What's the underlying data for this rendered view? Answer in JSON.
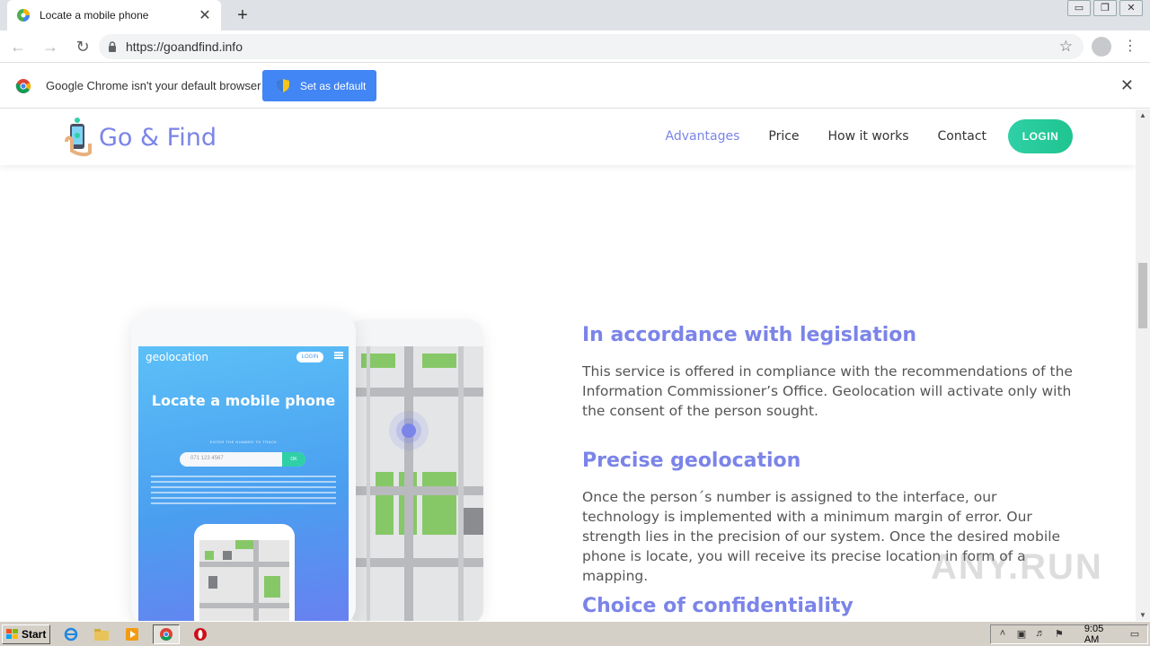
{
  "browser": {
    "tab_title": "Locate a mobile phone",
    "tab_close": "✕",
    "new_tab": "+",
    "url": "https://goandfind.info",
    "window_controls": [
      "▭",
      "❐",
      "✕"
    ]
  },
  "infobar": {
    "message": "Google Chrome isn't your default browser",
    "button": "Set as default",
    "close": "✕"
  },
  "site": {
    "brand": "Go & Find",
    "menu": [
      "Advantages",
      "Price",
      "How it works",
      "Contact"
    ],
    "login": "LOGIN",
    "phone_mock": {
      "brand": "geolocation",
      "login": "LOGIN",
      "headline": "Locate a mobile phone",
      "subtitle": "ENTER THE NUMBER TO TRACK",
      "placeholder": "071 123 4567",
      "ok": "OK"
    },
    "sections": [
      {
        "title": "In accordance with legislation",
        "body": "This service is offered in compliance with the recommendations of the Information Commissioner’s Office. Geolocation will activate only with the consent of the person sought."
      },
      {
        "title": "Precise geolocation",
        "body": "Once the person´s number is assigned to the interface, our technology is implemented with a minimum margin of error. Our strength lies in the precision of our system. Once the desired mobile phone is locate, you will receive its precise location in form of a mapping."
      },
      {
        "title": "Choice of confidentiality",
        "body": ""
      }
    ]
  },
  "watermark": "ANY.RUN",
  "taskbar": {
    "start": "Start",
    "clock": "9:05 AM"
  },
  "colors": {
    "accent": "#7b84e8",
    "login_green": "#2fd0a6",
    "chrome_blue": "#4285f4"
  }
}
